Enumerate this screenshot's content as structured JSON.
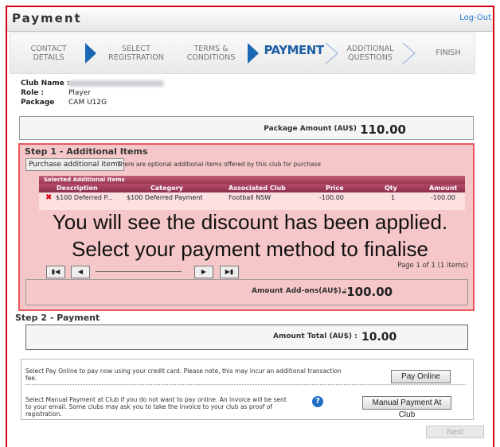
{
  "header": {
    "title": "Payment",
    "logout_label": "Log-Out"
  },
  "steps": [
    {
      "line1": "CONTACT",
      "line2": "DETAILS"
    },
    {
      "line1": "SELECT",
      "line2": "REGISTRATION"
    },
    {
      "line1": "TERMS &",
      "line2": "CONDITIONS"
    },
    {
      "line1": "PAYMENT",
      "line2": ""
    },
    {
      "line1": "ADDITIONAL",
      "line2": "QUESTIONS"
    },
    {
      "line1": "FINISH",
      "line2": ""
    }
  ],
  "club": {
    "club_name_label": "Club Name :",
    "role_label": "Role :",
    "role_value": "Player",
    "package_label": "Package",
    "package_value": "CAM U12G"
  },
  "package_amount": {
    "label": "Package Amount (AU$)",
    "value": "110.00"
  },
  "step1": {
    "heading": "Step 1 - Additional Items",
    "button_label": "Purchase additional items",
    "note": "There are optional additional items offered by this club for purchase",
    "grid_caption": "Selected Additional Items",
    "columns": [
      "Description",
      "Category",
      "Associated Club",
      "Price",
      "Qty",
      "Amount"
    ],
    "row": {
      "description": "$100 Deferred P...",
      "category": "$100 Deferred Payment",
      "club": "Football NSW",
      "price": "-100.00",
      "qty": "1",
      "amount": "-100.00"
    },
    "pager_info": "Page 1 of 1 (1 items)",
    "addons_label": "Amount Add-ons(AU$) :",
    "addons_value": "-100.00"
  },
  "overlay": {
    "line1": "You will see the discount has been applied.",
    "line2": "Select your payment method to finalise"
  },
  "step2": {
    "heading": "Step 2 - Payment",
    "total_label": "Amount Total (AU$) :",
    "total_value": "10.00",
    "online_text_1": "Select Pay Online to pay now using your credit card. Please note, this may incur an additional transaction",
    "online_text_2": "fee.",
    "online_button": "Pay Online",
    "manual_text_1": "Select Manual Payment at Club if you do not want to pay online. An invoice will be sent",
    "manual_text_2": "to your email. Some clubs may ask you to take the invoice to your club as proof of",
    "manual_text_3": "registration.",
    "manual_button": "Manual Payment At Club"
  },
  "next_label": "Next",
  "colors": {
    "accent": "#1a68b5",
    "highlight_border": "#e8575b",
    "highlight_fill": "#f6c7c8",
    "frame": "#d8000c"
  }
}
